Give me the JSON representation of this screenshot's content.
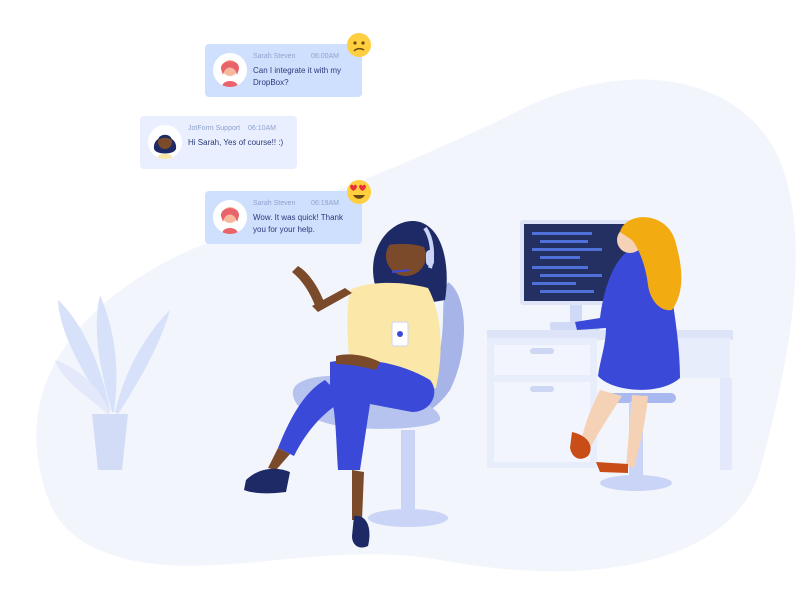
{
  "messages": [
    {
      "name": "Sarah Steven",
      "time": "06:00AM",
      "text_line1": "Can I integrate it with my",
      "text_line2": "DropBox?",
      "emoji": "confused-face-icon"
    },
    {
      "name": "JotForm Support",
      "time": "06:10AM",
      "text_line1": "Hi Sarah, Yes of course!! :)",
      "text_line2": ""
    },
    {
      "name": "Sarah Steven",
      "time": "06:19AM",
      "text_line1": "Wow. It was quick! Thank",
      "text_line2": "you for your help.",
      "emoji": "heart-eyes-face-icon"
    }
  ],
  "colors": {
    "bubble": "#cfe0ff",
    "bubble_alt": "#e9efff",
    "accent_blue": "#3a49d8",
    "hair_orange": "#f2ac12",
    "background_blob": "#f3f5fc"
  }
}
